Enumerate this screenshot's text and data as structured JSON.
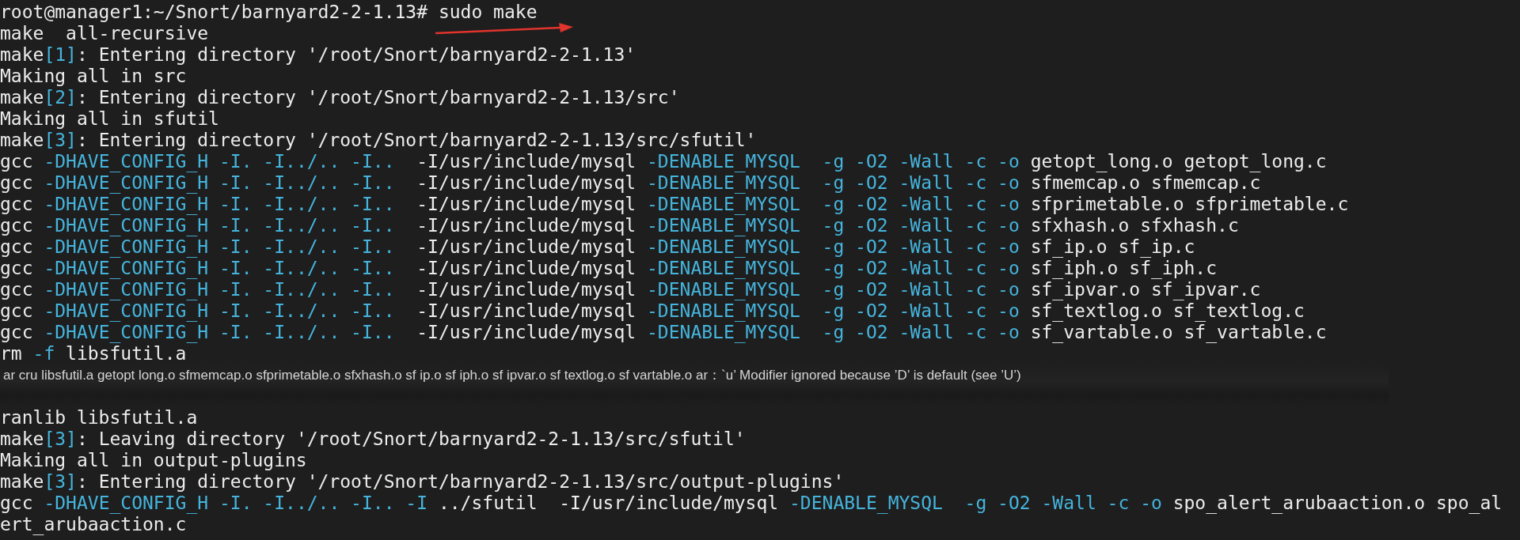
{
  "terminal": {
    "lines": [
      {
        "kind": "output",
        "segments": [
          {
            "text": "root@manager1:~/Snort/barnyard2-2-1.13# sudo make",
            "highlight": false
          }
        ]
      },
      {
        "kind": "output",
        "segments": [
          {
            "text": "make  all-recursive",
            "highlight": false
          }
        ]
      },
      {
        "kind": "output",
        "segments": [
          {
            "text": "make",
            "highlight": false
          },
          {
            "text": "[1]",
            "highlight": true
          },
          {
            "text": ": Entering directory '/root/Snort/barnyard2-2-1.13'",
            "highlight": false
          }
        ]
      },
      {
        "kind": "output",
        "segments": [
          {
            "text": "Making all in src",
            "highlight": false
          }
        ]
      },
      {
        "kind": "output",
        "segments": [
          {
            "text": "make",
            "highlight": false
          },
          {
            "text": "[2]",
            "highlight": true
          },
          {
            "text": ": Entering directory '/root/Snort/barnyard2-2-1.13/src'",
            "highlight": false
          }
        ]
      },
      {
        "kind": "output",
        "segments": [
          {
            "text": "Making all in sfutil",
            "highlight": false
          }
        ]
      },
      {
        "kind": "output",
        "segments": [
          {
            "text": "make",
            "highlight": false
          },
          {
            "text": "[3]",
            "highlight": true
          },
          {
            "text": ": Entering directory '/root/Snort/barnyard2-2-1.13/src/sfutil'",
            "highlight": false
          }
        ]
      },
      {
        "kind": "output",
        "segments": [
          {
            "text": "gcc ",
            "highlight": false
          },
          {
            "text": "-DHAVE_CONFIG_H -I. -I../.. -I..",
            "highlight": true
          },
          {
            "text": "  -I/usr/include/mysql ",
            "highlight": false
          },
          {
            "text": "-DENABLE_MYSQL  -g -O2 -Wall -c -o",
            "highlight": true
          },
          {
            "text": " getopt_long.o getopt_long.c",
            "highlight": false
          }
        ]
      },
      {
        "kind": "output",
        "segments": [
          {
            "text": "gcc ",
            "highlight": false
          },
          {
            "text": "-DHAVE_CONFIG_H -I. -I../.. -I..",
            "highlight": true
          },
          {
            "text": "  -I/usr/include/mysql ",
            "highlight": false
          },
          {
            "text": "-DENABLE_MYSQL  -g -O2 -Wall -c -o",
            "highlight": true
          },
          {
            "text": " sfmemcap.o sfmemcap.c",
            "highlight": false
          }
        ]
      },
      {
        "kind": "output",
        "segments": [
          {
            "text": "gcc ",
            "highlight": false
          },
          {
            "text": "-DHAVE_CONFIG_H -I. -I../.. -I..",
            "highlight": true
          },
          {
            "text": "  -I/usr/include/mysql ",
            "highlight": false
          },
          {
            "text": "-DENABLE_MYSQL  -g -O2 -Wall -c -o",
            "highlight": true
          },
          {
            "text": " sfprimetable.o sfprimetable.c",
            "highlight": false
          }
        ]
      },
      {
        "kind": "output",
        "segments": [
          {
            "text": "gcc ",
            "highlight": false
          },
          {
            "text": "-DHAVE_CONFIG_H -I. -I../.. -I..",
            "highlight": true
          },
          {
            "text": "  -I/usr/include/mysql ",
            "highlight": false
          },
          {
            "text": "-DENABLE_MYSQL  -g -O2 -Wall -c -o",
            "highlight": true
          },
          {
            "text": " sfxhash.o sfxhash.c",
            "highlight": false
          }
        ]
      },
      {
        "kind": "output",
        "segments": [
          {
            "text": "gcc ",
            "highlight": false
          },
          {
            "text": "-DHAVE_CONFIG_H -I. -I../.. -I..",
            "highlight": true
          },
          {
            "text": "  -I/usr/include/mysql ",
            "highlight": false
          },
          {
            "text": "-DENABLE_MYSQL  -g -O2 -Wall -c -o",
            "highlight": true
          },
          {
            "text": " sf_ip.o sf_ip.c",
            "highlight": false
          }
        ]
      },
      {
        "kind": "output",
        "segments": [
          {
            "text": "gcc ",
            "highlight": false
          },
          {
            "text": "-DHAVE_CONFIG_H -I. -I../.. -I..",
            "highlight": true
          },
          {
            "text": "  -I/usr/include/mysql ",
            "highlight": false
          },
          {
            "text": "-DENABLE_MYSQL  -g -O2 -Wall -c -o",
            "highlight": true
          },
          {
            "text": " sf_iph.o sf_iph.c",
            "highlight": false
          }
        ]
      },
      {
        "kind": "output",
        "segments": [
          {
            "text": "gcc ",
            "highlight": false
          },
          {
            "text": "-DHAVE_CONFIG_H -I. -I../.. -I..",
            "highlight": true
          },
          {
            "text": "  -I/usr/include/mysql ",
            "highlight": false
          },
          {
            "text": "-DENABLE_MYSQL  -g -O2 -Wall -c -o",
            "highlight": true
          },
          {
            "text": " sf_ipvar.o sf_ipvar.c",
            "highlight": false
          }
        ]
      },
      {
        "kind": "output",
        "segments": [
          {
            "text": "gcc ",
            "highlight": false
          },
          {
            "text": "-DHAVE_CONFIG_H -I. -I../.. -I..",
            "highlight": true
          },
          {
            "text": "  -I/usr/include/mysql ",
            "highlight": false
          },
          {
            "text": "-DENABLE_MYSQL  -g -O2 -Wall -c -o",
            "highlight": true
          },
          {
            "text": " sf_textlog.o sf_textlog.c",
            "highlight": false
          }
        ]
      },
      {
        "kind": "output",
        "segments": [
          {
            "text": "gcc ",
            "highlight": false
          },
          {
            "text": "-DHAVE_CONFIG_H -I. -I../.. -I..",
            "highlight": true
          },
          {
            "text": "  -I/usr/include/mysql ",
            "highlight": false
          },
          {
            "text": "-DENABLE_MYSQL  -g -O2 -Wall -c -o",
            "highlight": true
          },
          {
            "text": " sf_vartable.o sf_vartable.c",
            "highlight": false
          }
        ]
      },
      {
        "kind": "output",
        "segments": [
          {
            "text": "rm ",
            "highlight": false
          },
          {
            "text": "-f",
            "highlight": true
          },
          {
            "text": " libsfutil.a",
            "highlight": false
          }
        ]
      },
      {
        "kind": "note",
        "segments": [
          {
            "text": "ar cru libsfutil.a getopt long.o sfmemcap.o sfprimetable.o sfxhash.o sf ip.o sf iph.o sf ipvar.o sf textlog.o sf vartable.o ar：`u’ Modifier ignored because ’D’ is default (see ’U’)",
            "highlight": false
          }
        ]
      },
      {
        "kind": "output",
        "segments": [
          {
            "text": "ranlib libsfutil.a",
            "highlight": false
          }
        ]
      },
      {
        "kind": "output",
        "segments": [
          {
            "text": "make",
            "highlight": false
          },
          {
            "text": "[3]",
            "highlight": true
          },
          {
            "text": ": Leaving directory '/root/Snort/barnyard2-2-1.13/src/sfutil'",
            "highlight": false
          }
        ]
      },
      {
        "kind": "output",
        "segments": [
          {
            "text": "Making all in output-plugins",
            "highlight": false
          }
        ]
      },
      {
        "kind": "output",
        "segments": [
          {
            "text": "make",
            "highlight": false
          },
          {
            "text": "[3]",
            "highlight": true
          },
          {
            "text": ": Entering directory '/root/Snort/barnyard2-2-1.13/src/output-plugins'",
            "highlight": false
          }
        ]
      },
      {
        "kind": "output",
        "segments": [
          {
            "text": "gcc ",
            "highlight": false
          },
          {
            "text": "-DHAVE_CONFIG_H -I. -I../.. -I.. -I",
            "highlight": true
          },
          {
            "text": " ../sfutil  -I/usr/include/mysql ",
            "highlight": false
          },
          {
            "text": "-DENABLE_MYSQL  -g -O2 -Wall -c -o",
            "highlight": true
          },
          {
            "text": " spo_alert_arubaaction.o spo_al",
            "highlight": false
          }
        ]
      },
      {
        "kind": "output",
        "segments": [
          {
            "text": "ert_arubaaction.c",
            "highlight": false
          }
        ]
      }
    ]
  }
}
